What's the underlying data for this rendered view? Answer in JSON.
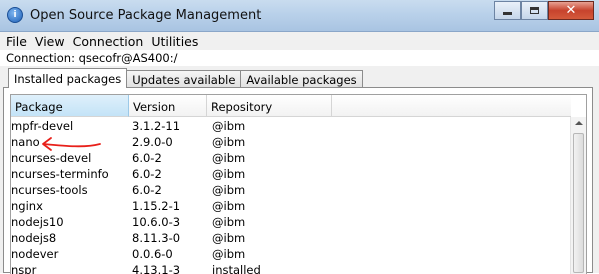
{
  "window": {
    "title": "Open Source Package Management",
    "close_glyph": "✕"
  },
  "menu": [
    "File",
    "View",
    "Connection",
    "Utilities"
  ],
  "connection_text": "Connection: qsecofr@AS400:/",
  "tabs": [
    {
      "label": "Installed packages",
      "active": true
    },
    {
      "label": "Updates available",
      "active": false
    },
    {
      "label": "Available packages",
      "active": false
    }
  ],
  "table": {
    "columns": [
      "Package",
      "Version",
      "Repository"
    ],
    "sorted_column": "Package",
    "rows": [
      [
        "mpfr-devel",
        "3.1.2-11",
        "@ibm"
      ],
      [
        "nano",
        "2.9.0-0",
        "@ibm"
      ],
      [
        "ncurses-devel",
        "6.0-2",
        "@ibm"
      ],
      [
        "ncurses-terminfo",
        "6.0-2",
        "@ibm"
      ],
      [
        "ncurses-tools",
        "6.0-2",
        "@ibm"
      ],
      [
        "nginx",
        "1.15.2-1",
        "@ibm"
      ],
      [
        "nodejs10",
        "10.6.0-3",
        "@ibm"
      ],
      [
        "nodejs8",
        "8.11.3-0",
        "@ibm"
      ],
      [
        "nodever",
        "0.0.6-0",
        "@ibm"
      ],
      [
        "nspr",
        "4.13.1-3",
        "installed"
      ]
    ]
  },
  "annotation": {
    "target": "nano",
    "color": "#e8201a",
    "icon": "red-arrow"
  }
}
